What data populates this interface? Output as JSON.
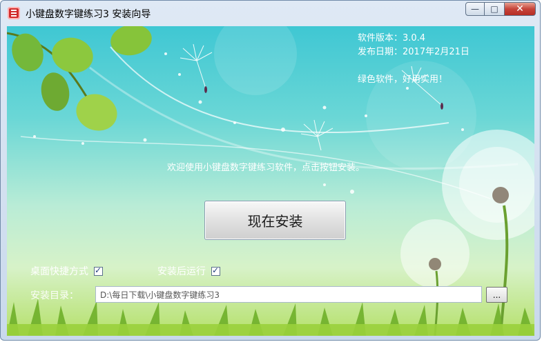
{
  "window": {
    "title": "小键盘数字键练习3 安装向导",
    "controls": {
      "minimize": "—",
      "maximize": "□",
      "close": "✕"
    }
  },
  "info": {
    "version_line": "软件版本：3.0.4",
    "release_line": "发布日期：2017年2月21日",
    "tagline": "绿色软件，好用实用！"
  },
  "welcome_text": "欢迎使用小键盘数字键练习软件，点击按钮安装。",
  "install_button_label": "现在安装",
  "options": {
    "desktop_shortcut_label": "桌面快捷方式",
    "desktop_shortcut_checked": true,
    "run_after_install_label": "安装后运行",
    "run_after_install_checked": true
  },
  "install_dir": {
    "label": "安装目录：",
    "value": "D:\\每日下载\\小键盘数字键练习3",
    "browse_label": "..."
  },
  "colors": {
    "sky_top": "#3fc7d3",
    "grass": "#b5e06a",
    "text_on_art": "#ffffff"
  }
}
